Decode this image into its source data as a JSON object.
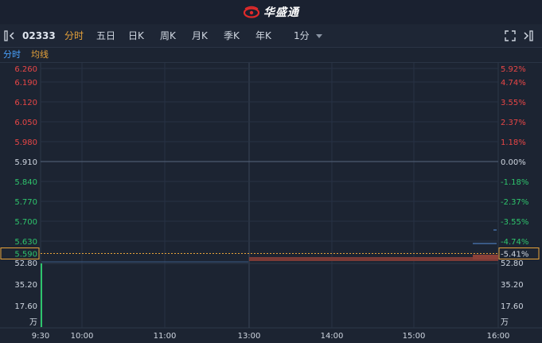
{
  "brand": {
    "name": "华盛通",
    "color": "#e02a2a"
  },
  "toolbar": {
    "code": "02333",
    "tabs": [
      {
        "label": "分时",
        "active": true
      },
      {
        "label": "五日",
        "active": false
      },
      {
        "label": "日K",
        "active": false
      },
      {
        "label": "周K",
        "active": false
      },
      {
        "label": "月K",
        "active": false
      },
      {
        "label": "季K",
        "active": false
      },
      {
        "label": "年K",
        "active": false
      }
    ],
    "interval": "1分"
  },
  "legend": {
    "time_label": "分时",
    "avg_label": "均线",
    "time_color": "#4aa3ff",
    "avg_color": "#e8a33a"
  },
  "chart_data": {
    "type": "line",
    "prev_close": 5.91,
    "price_ticks": [
      "6.260",
      "6.190",
      "6.120",
      "6.050",
      "5.980",
      "5.910",
      "5.840",
      "5.770",
      "5.700",
      "5.630"
    ],
    "percent_ticks": [
      "5.92%",
      "4.74%",
      "3.55%",
      "2.37%",
      "1.18%",
      "0.00%",
      "-1.18%",
      "-2.37%",
      "-3.55%",
      "-4.74%"
    ],
    "current_price": "5.590",
    "current_percent": "-5.41%",
    "volume_ticks": [
      "52.80",
      "35.20",
      "17.60"
    ],
    "volume_unit": "万",
    "time_labels": [
      "9:30",
      "10:00",
      "11:00",
      "13:00",
      "14:00",
      "15:00",
      "16:00"
    ],
    "colors": {
      "up": "#e84646",
      "down": "#2ec46c",
      "neutral": "#cfd6e0",
      "highlight": "#e8a33a",
      "volume": "#7a3a36"
    }
  }
}
